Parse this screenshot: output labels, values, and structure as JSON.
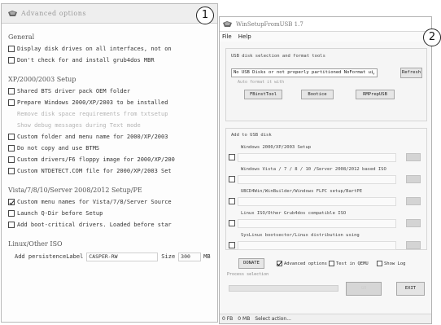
{
  "callouts": {
    "one": "1",
    "two": "2"
  },
  "advanced": {
    "title": "Advanced options",
    "general": {
      "title": "General",
      "options": [
        {
          "label": "Display disk drives on all interfaces, not on",
          "checked": false
        },
        {
          "label": "Don't check for and install grub4dos MBR",
          "checked": false
        }
      ]
    },
    "xp": {
      "title": "XP/2000/2003 Setup",
      "options": [
        {
          "label": "Shared BTS driver pack OEM folder",
          "checked": false
        },
        {
          "label": "Prepare Windows 2000/XP/2003 to be installed",
          "checked": false
        },
        {
          "label": "Remove disk space requirements from txtsetup",
          "disabled": true
        },
        {
          "label": "Show debug messages during Text mode",
          "disabled": true
        },
        {
          "label": "Custom folder and menu name for 2000/XP/2003",
          "checked": false
        },
        {
          "label": "Do not copy and use BTMS",
          "checked": false
        },
        {
          "label": "Custom drivers/F6 floppy image for 2000/XP/200",
          "checked": false
        },
        {
          "label": "Custom NTDETECT.COM file for 2000/XP/2003 Set",
          "checked": false
        }
      ]
    },
    "vista": {
      "title": "Vista/7/8/10/Server 2008/2012 Setup/PE",
      "options": [
        {
          "label": "Custom menu names for Vista/7/8/Server Source",
          "checked": true
        },
        {
          "label": "Launch Q-Dir before Setup",
          "checked": false
        },
        {
          "label": "Add boot-critical drivers. Loaded before star",
          "checked": false
        }
      ]
    },
    "linux": {
      "title": "Linux/Other ISO",
      "add_label": "Add persistence",
      "label_label": "Label",
      "label_value": "CASPER-RW",
      "size_label": "Size",
      "size_value": "300",
      "mb": "MB"
    }
  },
  "winsetup": {
    "title": "WinSetupFromUSB 1.7",
    "menu": [
      "File",
      "Help"
    ],
    "usb_section": "USB disk selection and format tools",
    "usb_disk": "No USB Disks or not properly partitioned NoFormat ui",
    "refresh_label": "Refresh",
    "auto_format": "Auto format it with",
    "fbinst": "FBinstTool",
    "bootice": "Bootice",
    "rmprep": "RMPrepUSB",
    "add_section": "Add to USB disk",
    "sources": [
      "Windows 2000/XP/2003 Setup",
      "Windows Vista / 7 / 8 / 10 /Server 2008/2012 based ISO",
      "UBCD4Win/WinBuilder/Windows FLPC setup/BartPE",
      "Linux ISO/Other Grub4dos compatible ISO",
      "SysLinux bootsector/Linux distribution using"
    ],
    "go_label": "GO",
    "donate_label": "DONATE",
    "advanced_label": "Advanced options",
    "test_qemu_label": "Test in QEMU",
    "show_log_label": "Show Log",
    "process_label": "Process selection",
    "exit_label": "EXIT",
    "status": {
      "files": "0 FB",
      "size": "0 MB",
      "action": "Select action..."
    }
  },
  "colors": {
    "window_bg": "#f7f7f7",
    "border": "#b3b3b3",
    "check": "#222222"
  }
}
